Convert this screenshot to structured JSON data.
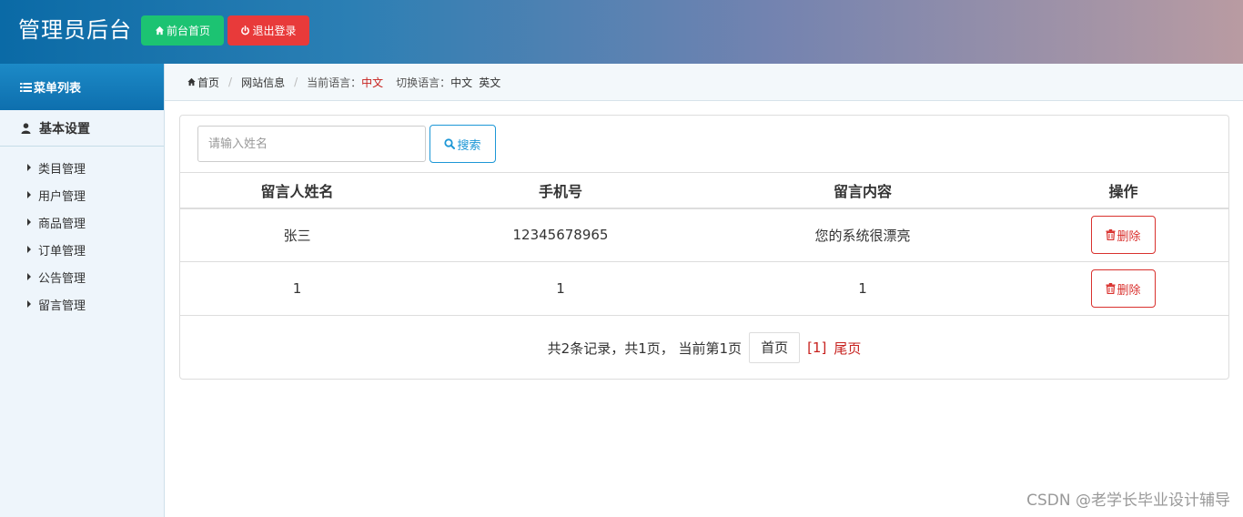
{
  "header": {
    "title": "管理员后台",
    "home_button": "前台首页",
    "logout_button": "退出登录",
    "colors": {
      "home_button": "#1cc372",
      "logout_button": "#e83a3a"
    }
  },
  "sidebar": {
    "heading": "菜单列表",
    "group": "基本设置",
    "items": [
      {
        "label": "类目管理"
      },
      {
        "label": "用户管理"
      },
      {
        "label": "商品管理"
      },
      {
        "label": "订单管理"
      },
      {
        "label": "公告管理"
      },
      {
        "label": "留言管理"
      }
    ]
  },
  "breadcrumb": {
    "home": "首页",
    "site_info": "网站信息",
    "current_lang_label": "当前语言：",
    "current_lang": "中文",
    "switch_label": "切换语言：",
    "lang_cn": "中文",
    "lang_en": "英文"
  },
  "search": {
    "placeholder": "请输入姓名",
    "button": "搜索"
  },
  "table": {
    "headers": [
      "留言人姓名",
      "手机号",
      "留言内容",
      "操作"
    ],
    "rows": [
      {
        "name": "张三",
        "phone": "12345678965",
        "content": "您的系统很漂亮",
        "action": "删除"
      },
      {
        "name": "1",
        "phone": "1",
        "content": "1",
        "action": "删除"
      }
    ]
  },
  "pagination": {
    "summary": "共2条记录，共1页， 当前第1页",
    "first": "首页",
    "current": "[1]",
    "last": "尾页"
  },
  "watermark": "CSDN @老学长毕业设计辅导"
}
